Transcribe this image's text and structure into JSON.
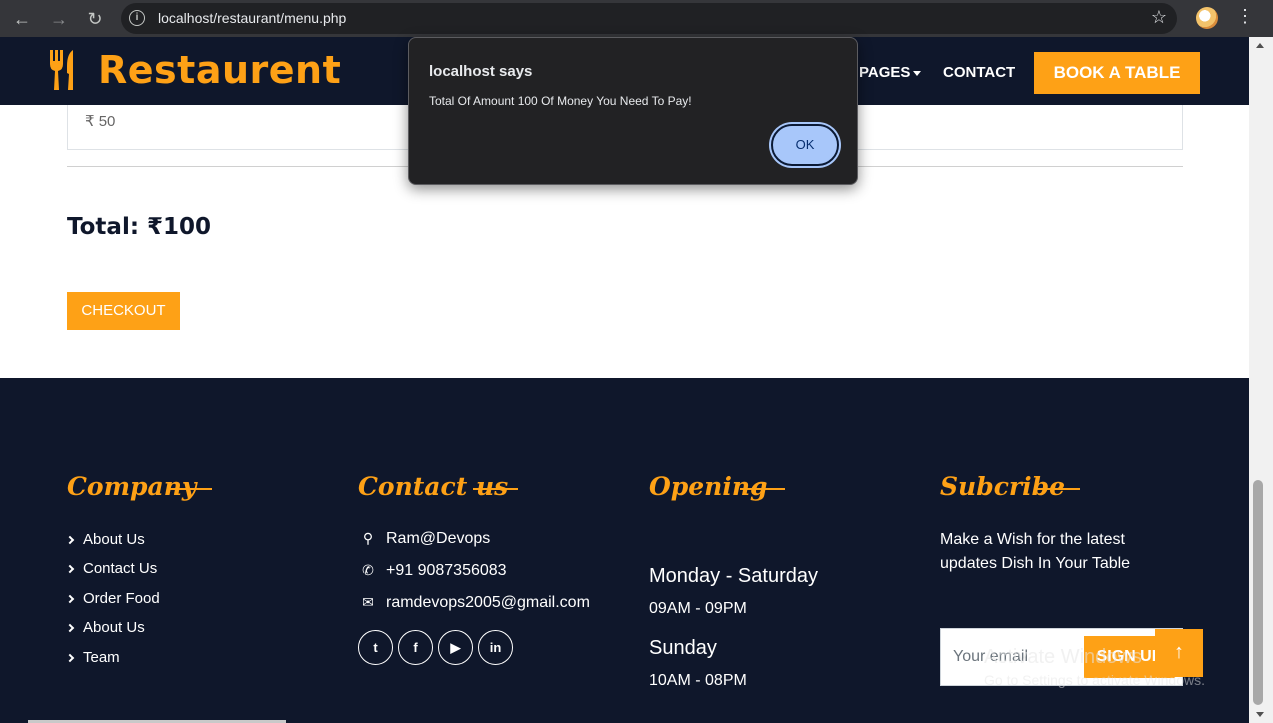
{
  "browser": {
    "url": "localhost/restaurant/menu.php"
  },
  "header": {
    "brand": "Restaurent",
    "nav": [
      {
        "label": "PAGES"
      },
      {
        "label": "CONTACT"
      }
    ],
    "book_button": "BOOK A TABLE"
  },
  "cart": {
    "item_price": "₹ 50",
    "total": "Total: ₹100",
    "checkout_label": "CHECKOUT"
  },
  "dialog": {
    "title": "localhost says",
    "message": "Total Of Amount 100 Of Money You Need To Pay!",
    "ok_label": "OK"
  },
  "footer": {
    "company": {
      "title": "Company",
      "links": [
        "About Us",
        "Contact Us",
        "Order Food",
        "About Us",
        "Team"
      ]
    },
    "contact": {
      "title": "Contact us",
      "address": "Ram@Devops",
      "phone": "+91 9087356083",
      "email": "ramdevops2005@gmail.com",
      "social_icons": [
        "twitter-icon",
        "facebook-icon",
        "youtube-icon",
        "linkedin-icon"
      ]
    },
    "opening": {
      "title": "Opening",
      "weekday_label": "Monday - Saturday",
      "weekday_hours": "09AM - 09PM",
      "sunday_label": "Sunday",
      "sunday_hours": "10AM - 08PM"
    },
    "subscribe": {
      "title": "Subcribe",
      "text": "Make a Wish for the latest updates Dish In Your Table",
      "placeholder": "Your email",
      "button": "SIGN UP"
    }
  },
  "watermark": {
    "line1": "Activate Windows",
    "line2": "Go to Settings to activate Windows."
  },
  "colors": {
    "accent": "#fea116",
    "dark": "#0f172b"
  }
}
